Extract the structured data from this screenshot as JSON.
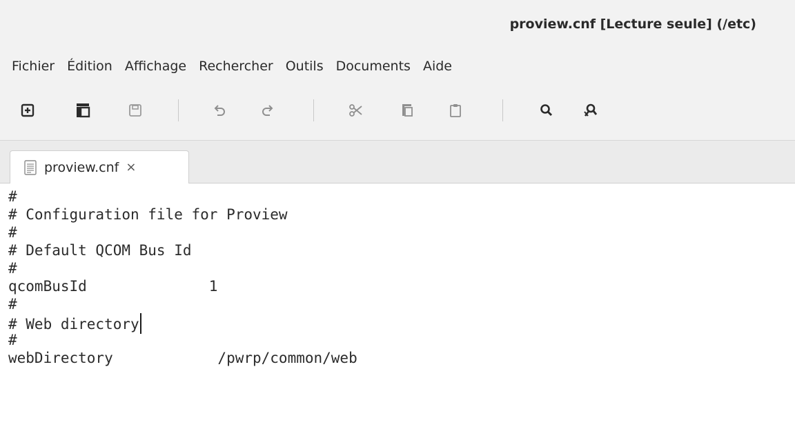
{
  "window": {
    "title": "proview.cnf [Lecture seule] (/etc)"
  },
  "menubar": {
    "items": [
      "Fichier",
      "Édition",
      "Affichage",
      "Rechercher",
      "Outils",
      "Documents",
      "Aide"
    ]
  },
  "toolbar": {
    "buttons": [
      {
        "icon": "new-document-icon",
        "enabled": true
      },
      {
        "icon": "open-document-icon",
        "enabled": true
      },
      {
        "icon": "save-icon",
        "enabled": false
      },
      {
        "icon": "undo-icon",
        "enabled": false
      },
      {
        "icon": "redo-icon",
        "enabled": false
      },
      {
        "icon": "cut-icon",
        "enabled": false
      },
      {
        "icon": "copy-icon",
        "enabled": false
      },
      {
        "icon": "paste-icon",
        "enabled": false
      },
      {
        "icon": "search-icon",
        "enabled": true
      },
      {
        "icon": "search-replace-icon",
        "enabled": true
      }
    ]
  },
  "tabs": [
    {
      "label": "proview.cnf",
      "close_glyph": "×",
      "icon": "text-file-icon",
      "active": true
    }
  ],
  "editor": {
    "lines": [
      "#",
      "# Configuration file for Proview",
      "#",
      "# Default QCOM Bus Id",
      "#",
      "qcomBusId              1",
      "#",
      "# Web directory",
      "#",
      "webDirectory            /pwrp/common/web"
    ],
    "cursor": {
      "line": 8,
      "column": 15
    }
  }
}
